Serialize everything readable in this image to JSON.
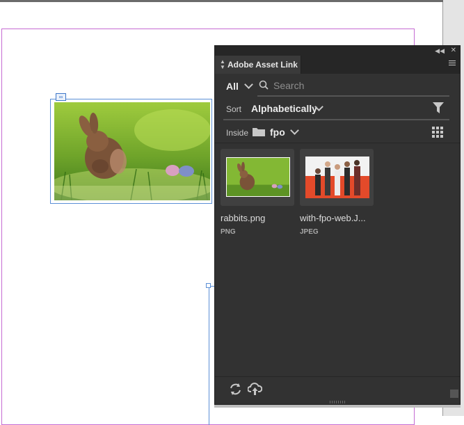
{
  "panel": {
    "title": "Adobe Asset Link",
    "filter": {
      "scope": "All",
      "search_placeholder": "Search"
    },
    "sort": {
      "label": "Sort",
      "value": "Alphabetically"
    },
    "inside": {
      "label": "Inside",
      "folder": "fpo"
    },
    "assets": [
      {
        "name": "rabbits.png",
        "type": "PNG"
      },
      {
        "name": "with-fpo-web.J...",
        "type": "JPEG"
      }
    ]
  },
  "icons": [
    "chevron-double-left-icon",
    "close-icon",
    "panel-menu-icon",
    "search-icon",
    "filter-icon",
    "folder-icon",
    "grid-view-icon",
    "refresh-icon",
    "cloud-upload-icon",
    "link-badge-icon"
  ],
  "colors": {
    "panel_bg": "#323232",
    "frame_blue": "#5b8fd6",
    "margin_magenta": "#c56ad3"
  }
}
